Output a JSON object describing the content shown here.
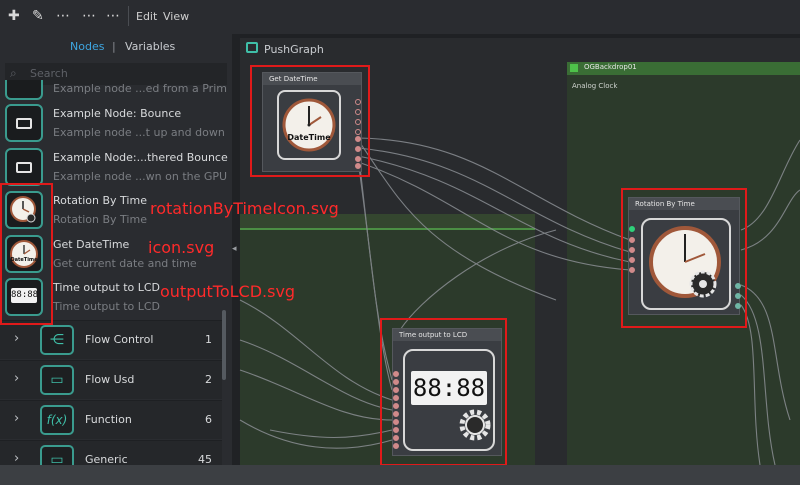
{
  "menu": {
    "edit": "Edit",
    "view": "View"
  },
  "tabs": {
    "nodes": "Nodes",
    "sep": "|",
    "variables": "Variables"
  },
  "search": {
    "placeholder": "Search"
  },
  "list_items": [
    {
      "title": "",
      "subtitle": "Example node ...ed from a Prim"
    },
    {
      "title": "Example Node: Bounce",
      "subtitle": "Example node ...t up and down"
    },
    {
      "title": "Example Node:...thered Bounce",
      "subtitle": "Example node ...wn on the GPU"
    },
    {
      "title": "Rotation By Time",
      "subtitle": "Rotation By Time"
    },
    {
      "title": "Get DateTime",
      "subtitle": "Get current date and time"
    },
    {
      "title": "Time output to LCD",
      "subtitle": "Time output to LCD"
    }
  ],
  "categories": [
    {
      "name": "Flow Control",
      "count": "1",
      "icon": "flow-control-icon"
    },
    {
      "name": "Flow Usd",
      "count": "2",
      "icon": "flow-usd-icon"
    },
    {
      "name": "Function",
      "count": "6",
      "icon": "function-icon"
    },
    {
      "name": "Generic",
      "count": "45",
      "icon": "generic-icon"
    }
  ],
  "graph": {
    "tab_title": "PushGraph",
    "backdrop_title": "OGBackdrop01",
    "backdrop_subtitle": "Analog Clock",
    "node_get_datetime": "Get DateTime",
    "node_rotation": "Rotation By Time",
    "node_lcd": "Time output to LCD",
    "datetime_icon_text": "DateTime",
    "lcd_text": "88:88"
  },
  "annotations": {
    "rotation_svg": "rotationByTimeIcon.svg",
    "icon_svg": "icon.svg",
    "lcd_svg": "outputToLCD.svg"
  },
  "colors": {
    "accent": "#3fbfa8",
    "highlight": "#e01a1a",
    "tab_active": "#3ea6e0",
    "backdrop": "#2e5f2b"
  }
}
